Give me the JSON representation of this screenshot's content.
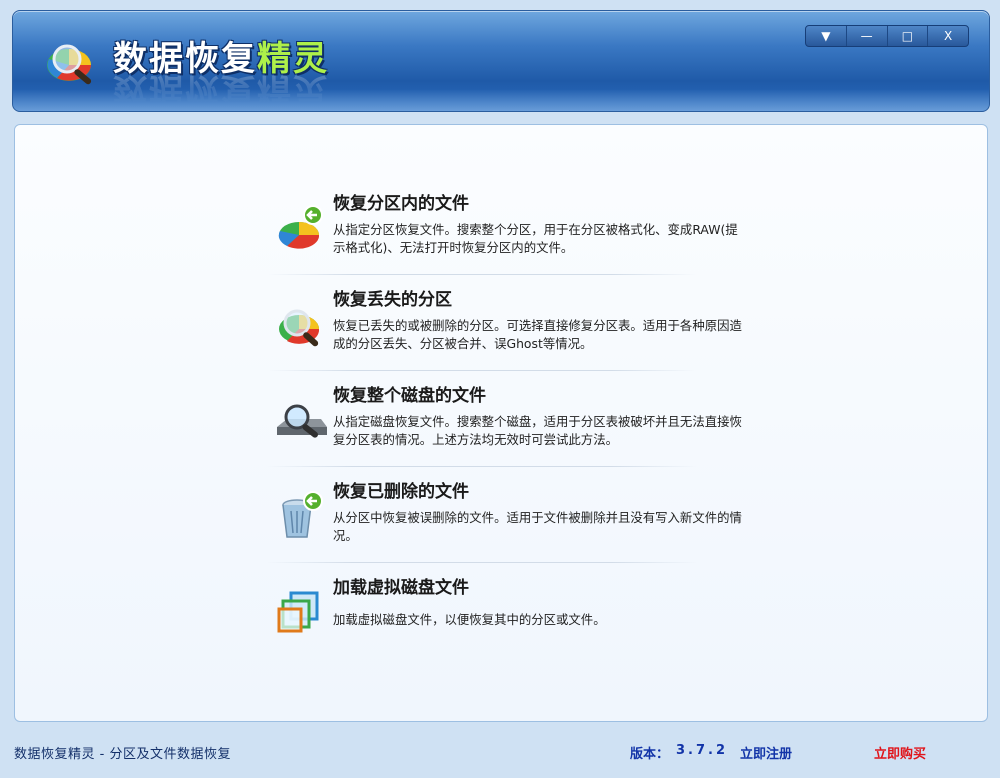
{
  "app": {
    "title_main": "数据恢复",
    "title_highlight": "精灵",
    "logo_icon": "magnifier-pie-icon"
  },
  "window_controls": {
    "dropdown": "▼",
    "minimize": "—",
    "maximize": "□",
    "close": "X"
  },
  "options": [
    {
      "title": "恢复分区内的文件",
      "description": "从指定分区恢复文件。搜索整个分区，用于在分区被格式化、变成RAW(提示格式化)、无法打开时恢复分区内的文件。",
      "icon": "partition-files-icon"
    },
    {
      "title": "恢复丢失的分区",
      "description": "恢复已丢失的或被删除的分区。可选择直接修复分区表。适用于各种原因造成的分区丢失、分区被合并、误Ghost等情况。",
      "icon": "lost-partition-icon"
    },
    {
      "title": "恢复整个磁盘的文件",
      "description": "从指定磁盘恢复文件。搜索整个磁盘，适用于分区表被破坏并且无法直接恢复分区表的情况。上述方法均无效时可尝试此方法。",
      "icon": "disk-search-icon"
    },
    {
      "title": "恢复已删除的文件",
      "description": "从分区中恢复被误删除的文件。适用于文件被删除并且没有写入新文件的情况。",
      "icon": "recycle-bin-icon"
    },
    {
      "title": "加载虚拟磁盘文件",
      "description": "加载虚拟磁盘文件，以便恢复其中的分区或文件。",
      "icon": "virtual-disk-icon"
    }
  ],
  "status": {
    "left_text": "数据恢复精灵 - 分区及文件数据恢复",
    "version_label": "版本：",
    "version_value": "3.7.2",
    "register": "立即注册",
    "buy": "立即购买"
  },
  "colors": {
    "header_blue": "#1f5aa8",
    "title_green": "#aef04a",
    "link_blue": "#1234a8",
    "buy_red": "#e0141a"
  }
}
